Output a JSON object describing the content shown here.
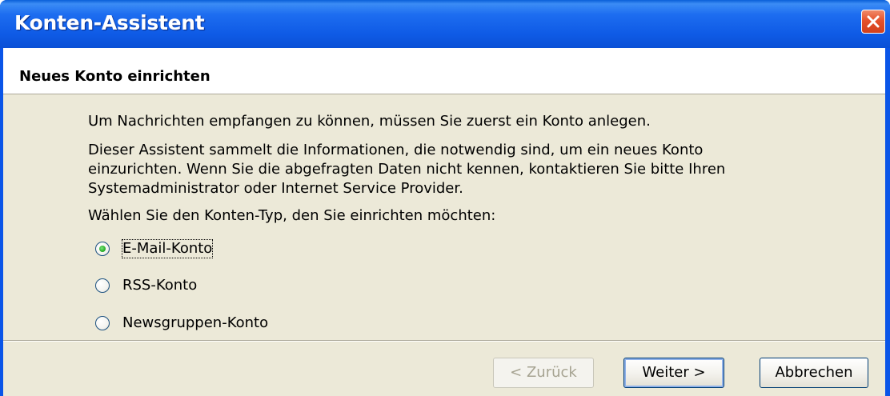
{
  "window": {
    "title": "Konten-Assistent"
  },
  "header": {
    "title": "Neues Konto einrichten"
  },
  "content": {
    "intro": "Um Nachrichten empfangen zu können, müssen Sie zuerst ein Konto anlegen.",
    "description": "Dieser Assistent sammelt die Informationen, die notwendig sind, um ein neues Konto einzurichten. Wenn Sie die abgefragten Daten nicht kennen, kontaktieren Sie bitte Ihren Systemadministrator oder Internet Service Provider.",
    "prompt": "Wählen Sie den Konten-Typ, den Sie einrichten möchten:"
  },
  "options": [
    {
      "label": "E-Mail-Konto",
      "selected": true
    },
    {
      "label": "RSS-Konto",
      "selected": false
    },
    {
      "label": "Newsgruppen-Konto",
      "selected": false
    }
  ],
  "buttons": {
    "back": "< Zurück",
    "next": "Weiter >",
    "cancel": "Abbrechen"
  },
  "icons": {
    "close": "close-icon"
  },
  "colors": {
    "titlebar": "#0a55e8",
    "dialog_bg": "#ece9d8",
    "close_button": "#e5512b",
    "radio_selected": "#2bb02b"
  }
}
